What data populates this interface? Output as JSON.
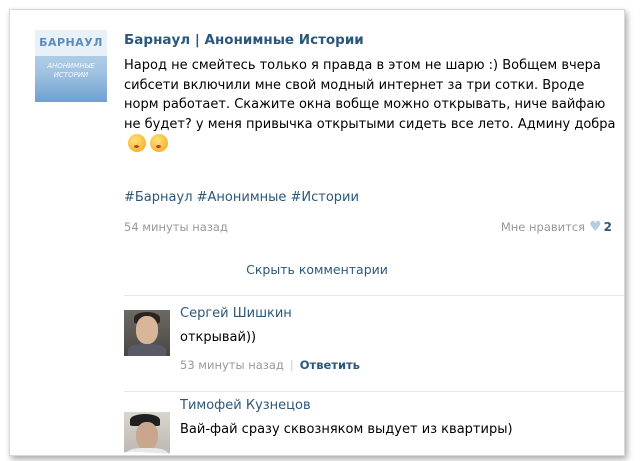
{
  "post": {
    "group_logo_title": "БАРНАУЛ",
    "group_logo_subtitle": "АНОНИМНЫЕ ИСТОРИИ",
    "author": "Барнаул | Анонимные Истории",
    "text": "Народ не смейтесь только я правда в этом не шарю :) Вобщем вчера сибсети включили мне свой модный интернет за три сотки. Вроде норм работает. Скажите окна вобще можно открывать, ниче вайфаю не будет? у меня привычка открытыми сидеть все лето. Админу добра",
    "hashtags": "#Барнаул #Анонимные #Истории",
    "time": "54 минуты назад",
    "like_label": "Мне нравится",
    "like_count": "2"
  },
  "hide_comments_label": "Скрыть комментарии",
  "comments": [
    {
      "author": "Сергей Шишкин",
      "text": "открывай))",
      "time": "53 минуты назад",
      "reply_label": "Ответить"
    },
    {
      "author": "Тимофей Кузнецов",
      "text": "Вай-фай сразу сквозняком выдует из квартиры)"
    }
  ],
  "colors": {
    "link": "#2b587a",
    "meta": "#999999",
    "divider": "#e5e9ee"
  }
}
